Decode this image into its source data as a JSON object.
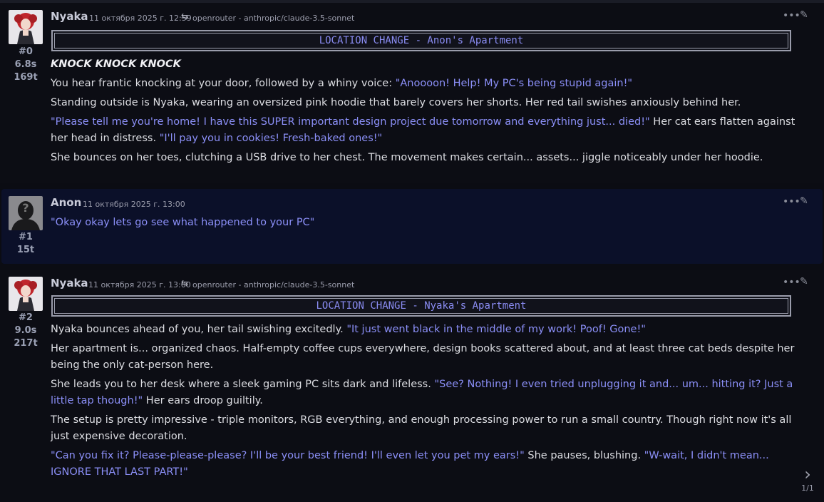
{
  "messages": [
    {
      "name": "Nyaka",
      "index": "#0",
      "time_s": "6.8s",
      "tokens": "169t",
      "timestamp": "11 октября 2025 г. 12:59",
      "model": "openrouter - anthropic/claude-3.5-sonnet",
      "location": "LOCATION CHANGE - Anon's Apartment",
      "emphasis": "KNOCK KNOCK KNOCK",
      "p1_text": "You hear frantic knocking at your door, followed by a whiny voice: ",
      "p1_quote": "\"Anoooon! Help! My PC's being stupid again!\"",
      "p2_text": "Standing outside is Nyaka, wearing an oversized pink hoodie that barely covers her shorts. Her red tail swishes anxiously behind her.",
      "p3_quote1": "\"Please tell me you're home! I have this SUPER important design project due tomorrow and everything just... died!\"",
      "p3_text": " Her cat ears flatten against her head in distress. ",
      "p3_quote2": "\"I'll pay you in cookies! Fresh-baked ones!\"",
      "p4_text": "She bounces on her toes, clutching a USB drive to her chest. The movement makes certain... assets... jiggle noticeably under her hoodie."
    },
    {
      "name": "Anon",
      "index": "#1",
      "tokens": "15t",
      "timestamp": "11 октября 2025 г. 13:00",
      "p1_quote": "\"Okay okay lets go see what happened to your PC\""
    },
    {
      "name": "Nyaka",
      "index": "#2",
      "time_s": "9.0s",
      "tokens": "217t",
      "timestamp": "11 октября 2025 г. 13:00",
      "model": "openrouter - anthropic/claude-3.5-sonnet",
      "location": "LOCATION CHANGE - Nyaka's Apartment",
      "p1_text": "Nyaka bounces ahead of you, her tail swishing excitedly. ",
      "p1_quote": "\"It just went black in the middle of my work! Poof! Gone!\"",
      "p2_text": "Her apartment is... organized chaos. Half-empty coffee cups everywhere, design books scattered about, and at least three cat beds despite her being the only cat-person here.",
      "p3_text": "She leads you to her desk where a sleek gaming PC sits dark and lifeless. ",
      "p3_quote": "\"See? Nothing! I even tried unplugging it and... um... hitting it? Just a little tap though!\"",
      "p3_text2": " Her ears droop guiltily.",
      "p4_text": "The setup is pretty impressive - triple monitors, RGB everything, and enough processing power to run a small country. Though right now it's all just expensive decoration.",
      "p5_quote1": "\"Can you fix it? Please-please-please? I'll be your best friend! I'll even let you pet my ears!\"",
      "p5_text": " She pauses, blushing. ",
      "p5_quote2": "\"W-wait, I didn't mean... IGNORE THAT LAST PART!\""
    }
  ],
  "icons": {
    "menu": "more-dots-icon",
    "edit": "pencil-icon",
    "swap": "swap-arrows-icon",
    "next": "chevron-right-icon"
  },
  "pager": {
    "count": "1/1"
  },
  "colors": {
    "quote": "#8b8ff7",
    "location": "#8a8cf2",
    "background": "#0b0c13"
  }
}
